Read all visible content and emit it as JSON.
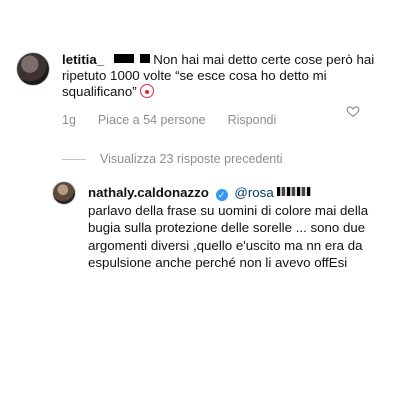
{
  "comment": {
    "username": "letitia_",
    "text": "Non hai mai detto certe cose però hai ripetuto 1000 volte “se esce cosa ho detto mi squalificano”",
    "emoji": "clown-emoji",
    "time": "1g",
    "likes": "Piace a 54 persone",
    "reply_label": "Rispondi"
  },
  "view_replies": "Visualizza 23 risposte precedenti",
  "reply": {
    "username": "nathaly.caldonazzo",
    "mention": "@rosa",
    "text": "parlavo della frase su uomini di colore mai della bugia sulla protezione delle sorelle ... sono due argomenti diversi ,quello e'uscito ma nn era da espulsione anche perché non li avevo offEsi"
  },
  "colors": {
    "muted": "#8e8e8e",
    "verified": "#3797f0",
    "mention": "#00376b"
  }
}
